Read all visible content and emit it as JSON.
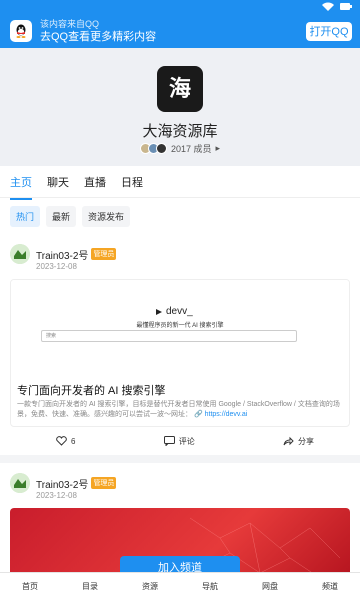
{
  "qq_bar": {
    "subtitle": "该内容来自QQ",
    "message": "去QQ查看更多精彩内容",
    "open_label": "打开QQ"
  },
  "group": {
    "name": "大海资源库",
    "members": "2017 成员"
  },
  "tabs": [
    "主页",
    "聊天",
    "直播",
    "日程"
  ],
  "chips": [
    "热门",
    "最新",
    "资源发布"
  ],
  "posts": [
    {
      "user": "Train03-2号",
      "badge": "管理员",
      "date": "2023-12-08",
      "preview": {
        "logo": "devv_",
        "subtitle": "最懂程序员的新一代 AI 搜索引擎",
        "input_placeholder": "搜索"
      },
      "title": "专门面向开发者的 AI 搜索引擎",
      "desc": "一款专门面向开发者的 AI 搜索引擎，目标是替代开发者日常使用 Google / StackOverflow / 文档查询的场景，免费、快速、准确。感兴趣的可以尝试一波～网址：",
      "link": "https://devv.ai",
      "likes": "6",
      "comment_label": "评论",
      "share_label": "分享"
    },
    {
      "user": "Train03-2号",
      "badge": "管理员",
      "date": "2023-12-08"
    }
  ],
  "join_label": "加入频道",
  "bottom_nav": [
    "首页",
    "目录",
    "资源",
    "导航",
    "网盘",
    "频道"
  ],
  "colors": {
    "accent": "#1e8ff0",
    "badge": "#f5a524"
  }
}
